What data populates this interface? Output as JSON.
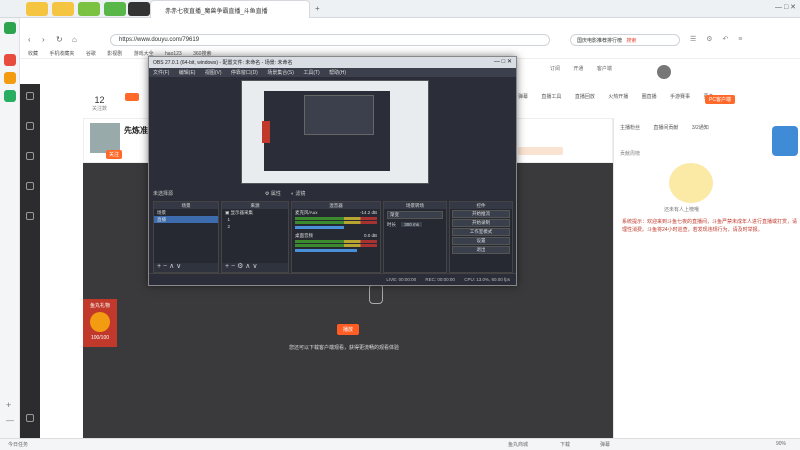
{
  "browser": {
    "tab_title": "赤赤七夜直播_魔兽争霸直播_斗鱼直播",
    "url": "https://www.douyu.com/79619",
    "search_placeholder": "国庆电影推荐排行榜",
    "search_badge": "搜索",
    "bookmarks": [
      "收藏",
      "手机收藏夹",
      "谷歌",
      "影视剧",
      "游戏大全",
      "hao123",
      "360搜索"
    ]
  },
  "site": {
    "follow_count": "12",
    "follow_label": "关注数",
    "header_icons": [
      "订阅",
      "开通",
      "客户端"
    ],
    "stream_nav": [
      "弹幕",
      "直播工具",
      "直播回放",
      "火热开播",
      "圈直播",
      "手游赛事",
      "更多"
    ],
    "pc_badge": "PC客户端",
    "streamer_name": "先炼准度",
    "follow_btn": "关注",
    "view_hint": "您还可以下载客户端观看，获得更流畅的观看体验",
    "play_btn": "播放",
    "gift_count": "100/100",
    "gift_label": "鱼丸礼物"
  },
  "chat": {
    "tabs": [
      "主播粉丝",
      "直播间贡献",
      "3/2通知"
    ],
    "ranking_label": "贡献周榜",
    "mascot_caption": "还未有人上榜哦",
    "notice": "系统提示：欢迎来到斗鱼七夜的直播间，斗鱼严禁未成年人进行直播或打赏，请理性消费。斗鱼将24小时巡查，若发现违规行为，请及时举报。"
  },
  "bottom": {
    "left": "今日任务",
    "items": [
      "鱼丸商城",
      "下载",
      "弹幕"
    ],
    "zoom": "90%"
  },
  "obs": {
    "title": "OBS 27.0.1 (64-bit, windows) - 配置文件: 未命名 - 场景: 未命名",
    "menu": [
      "文件(F)",
      "编辑(E)",
      "视图(V)",
      "停靠窗口(D)",
      "场景集合(S)",
      "工具(T)",
      "帮助(H)"
    ],
    "scene_label": "未选择源",
    "props": "属性",
    "filters": "滤镜",
    "docks": {
      "scenes": {
        "title": "场景",
        "items": [
          "场景",
          "直播"
        ]
      },
      "sources": {
        "title": "来源",
        "items": [
          "显示器采集",
          "1",
          "2"
        ]
      },
      "mixer": {
        "title": "混音器",
        "channels": [
          {
            "name": "麦克风/Aux",
            "db": "-14.2 dB"
          },
          {
            "name": "桌面音频",
            "db": "0.0 dB"
          }
        ]
      },
      "transitions": {
        "title": "场景转场",
        "type": "渐变",
        "duration_label": "时长",
        "duration": "300 ms"
      },
      "controls": {
        "title": "控件",
        "buttons": [
          "开始推流",
          "开始录制",
          "工作室模式",
          "设置",
          "退出"
        ]
      }
    },
    "status": {
      "live": "LIVE: 00:00:00",
      "rec": "REC: 00:00:00",
      "cpu": "CPU: 13.0%, 60.00 fps"
    }
  }
}
